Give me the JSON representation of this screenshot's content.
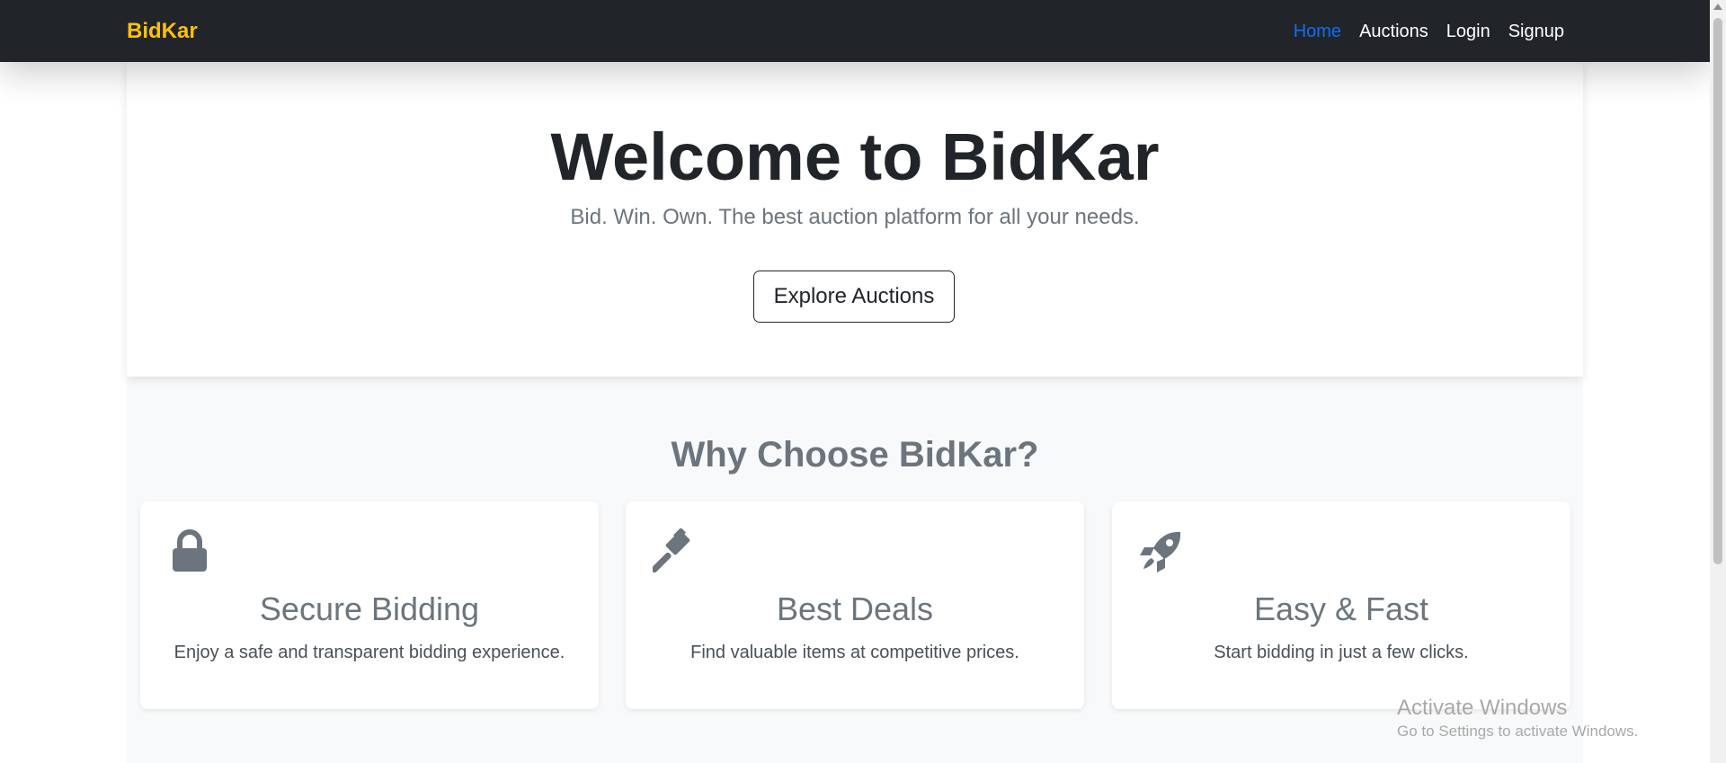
{
  "navbar": {
    "brand": "BidKar",
    "links": [
      {
        "label": "Home",
        "active": true
      },
      {
        "label": "Auctions",
        "active": false
      },
      {
        "label": "Login",
        "active": false
      },
      {
        "label": "Signup",
        "active": false
      }
    ]
  },
  "hero": {
    "title": "Welcome to BidKar",
    "tagline": "Bid. Win. Own. The best auction platform for all your needs.",
    "button_label": "Explore Auctions"
  },
  "features": {
    "heading": "Why Choose BidKar?",
    "cards": [
      {
        "icon": "lock-icon",
        "title": "Secure Bidding",
        "text": "Enjoy a safe and transparent bidding experience."
      },
      {
        "icon": "gavel-icon",
        "title": "Best Deals",
        "text": "Find valuable items at competitive prices."
      },
      {
        "icon": "rocket-icon",
        "title": "Easy & Fast",
        "text": "Start bidding in just a few clicks."
      }
    ]
  },
  "watermark": {
    "title": "Activate Windows",
    "subtitle": "Go to Settings to activate Windows."
  },
  "colors": {
    "navbar_bg": "#212529",
    "brand": "#ffc107",
    "active_link": "#0d6efd",
    "muted": "#6c757d",
    "features_bg": "#f8f9fa"
  }
}
